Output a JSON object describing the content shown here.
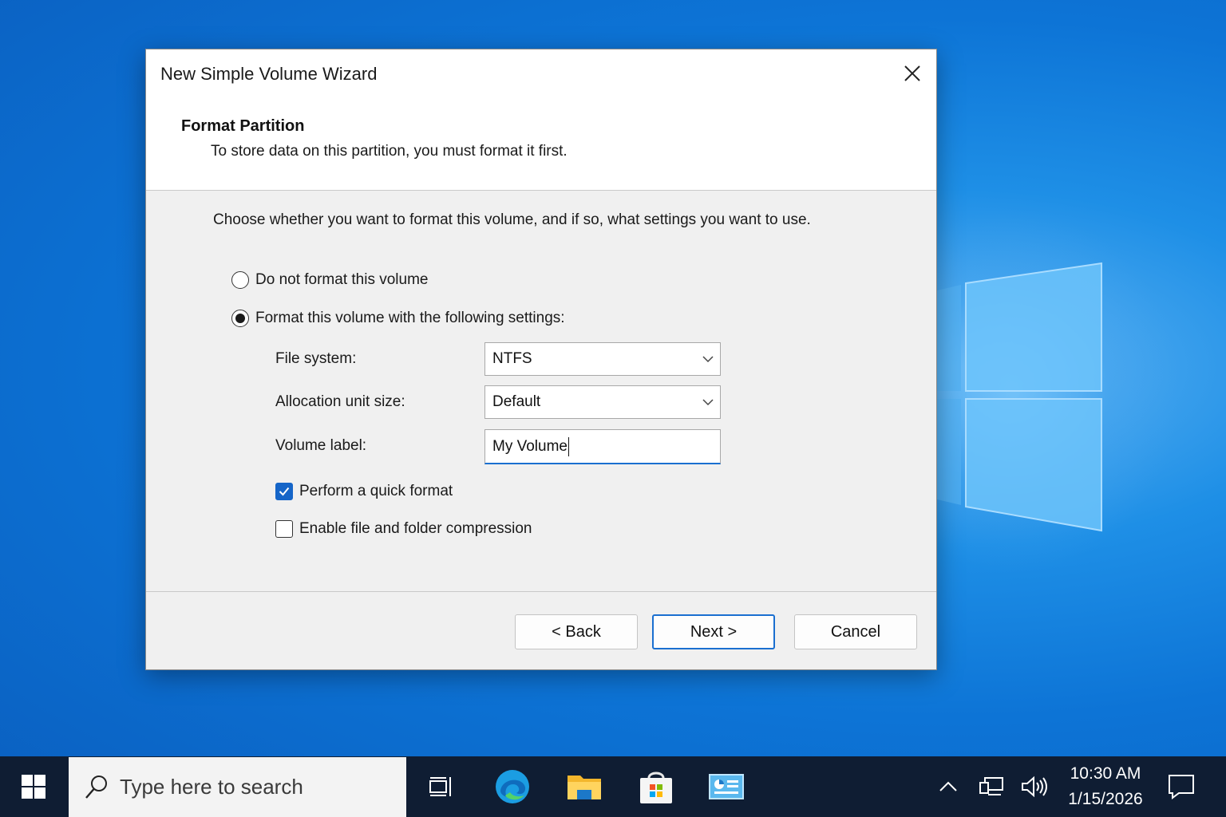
{
  "dialog": {
    "title": "New Simple Volume Wizard",
    "heading": "Format Partition",
    "subheading": "To store data on this partition, you must format it first.",
    "intro": "Choose whether you want to format this volume, and if so, what settings you want to use.",
    "options": {
      "no_format": "Do not format this volume",
      "format": "Format this volume with the following settings:",
      "selected": "format"
    },
    "file_system": {
      "label": "File system:",
      "value": "NTFS"
    },
    "allocation": {
      "label": "Allocation unit size:",
      "value": "Default"
    },
    "volume_label": {
      "label": "Volume label:",
      "value": "My Volume"
    },
    "quick_format": {
      "label": "Perform a quick format",
      "checked": true
    },
    "compression": {
      "label": "Enable file and folder compression",
      "checked": false
    },
    "buttons": {
      "back": "< Back",
      "next": "Next >",
      "cancel": "Cancel"
    }
  },
  "taskbar": {
    "search_placeholder": "Type here to search",
    "time": "10:30 AM",
    "date": "1/15/2026",
    "apps": [
      "task-view-icon",
      "edge-icon",
      "file-explorer-icon",
      "store-icon",
      "control-panel-icon"
    ]
  },
  "colors": {
    "accent": "#1a6fd0",
    "taskbar": "#0f1d33",
    "desktop": "#0d74d6"
  }
}
